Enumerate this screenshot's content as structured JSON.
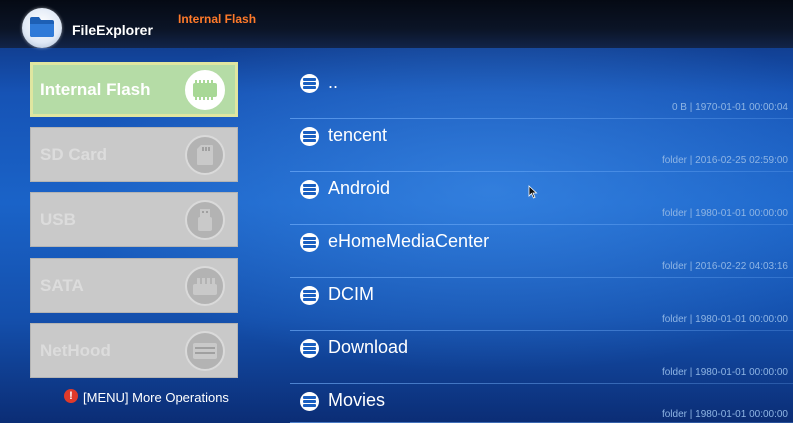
{
  "header": {
    "app_title": "FileExplorer",
    "location": "Internal Flash"
  },
  "sidebar": {
    "items": [
      {
        "label": "Internal Flash",
        "icon": "memory-chip-icon",
        "active": true
      },
      {
        "label": "SD Card",
        "icon": "sd-card-icon",
        "active": false
      },
      {
        "label": "USB",
        "icon": "usb-drive-icon",
        "active": false
      },
      {
        "label": "SATA",
        "icon": "sata-drive-icon",
        "active": false
      },
      {
        "label": "NetHood",
        "icon": "network-drive-icon",
        "active": false
      }
    ],
    "menu_hint": "[MENU] More Operations"
  },
  "files": [
    {
      "name": "..",
      "meta": "0 B | 1970-01-01 00:00:04"
    },
    {
      "name": "tencent",
      "meta": "folder | 2016-02-25 02:59:00"
    },
    {
      "name": "Android",
      "meta": "folder | 1980-01-01 00:00:00"
    },
    {
      "name": "eHomeMediaCenter",
      "meta": "folder | 2016-02-22 04:03:16"
    },
    {
      "name": "DCIM",
      "meta": "folder | 1980-01-01 00:00:00"
    },
    {
      "name": "Download",
      "meta": "folder | 1980-01-01 00:00:00"
    },
    {
      "name": "Movies",
      "meta": "folder | 1980-01-01 00:00:00"
    }
  ],
  "colors": {
    "location_accent": "#ff7a2a",
    "active_item_bg": "#b5dca6",
    "inactive_item_bg": "#c9c9c9",
    "meta_text": "#8fb5e4",
    "warning": "#e03a2a"
  }
}
